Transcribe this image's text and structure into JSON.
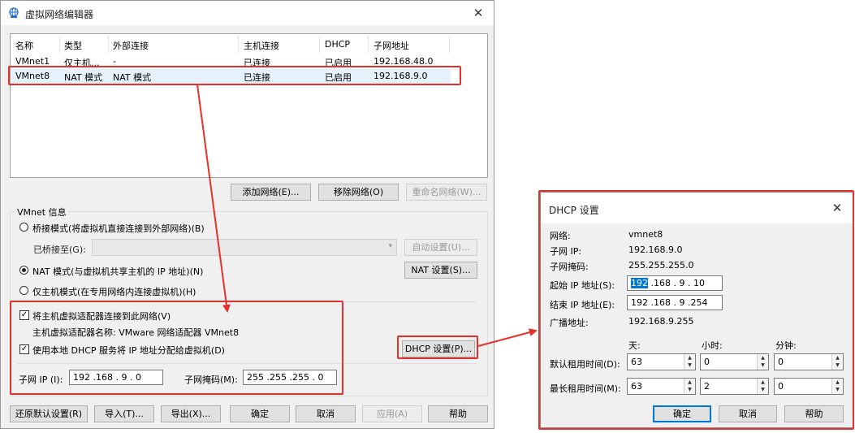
{
  "main_window": {
    "title": "虚拟网络编辑器",
    "close": "✕",
    "columns": [
      "名称",
      "类型",
      "外部连接",
      "主机连接",
      "DHCP",
      "子网地址"
    ],
    "rows": [
      [
        "VMnet1",
        "仅主机...",
        "-",
        "已连接",
        "已启用",
        "192.168.48.0"
      ],
      [
        "VMnet8",
        "NAT 模式",
        "NAT 模式",
        "已连接",
        "已启用",
        "192.168.9.0"
      ]
    ],
    "add_network": "添加网络(E)...",
    "remove_network": "移除网络(O)",
    "rename_network": "重命名网络(W)...",
    "vmnet_info": "VMnet 信息",
    "bridged_mode": "桥接模式(将虚拟机直接连接到外部网络)(B)",
    "bridged_to": "已桥接至(G):",
    "auto_settings": "自动设置(U)...",
    "nat_mode": "NAT 模式(与虚拟机共享主机的 IP 地址)(N)",
    "nat_settings": "NAT 设置(S)...",
    "host_only": "仅主机模式(在专用网络内连接虚拟机)(H)",
    "connect_adapter": "将主机虚拟适配器连接到此网络(V)",
    "adapter_name": "主机虚拟适配器名称: VMware 网络适配器 VMnet8",
    "use_dhcp": "使用本地 DHCP 服务将 IP 地址分配给虚拟机(D)",
    "dhcp_settings": "DHCP 设置(P)...",
    "subnet_ip_label": "子网 IP (I):",
    "subnet_ip": "192 .168 . 9 . 0",
    "subnet_mask_label": "子网掩码(M):",
    "subnet_mask": "255 .255 .255 . 0",
    "restore_defaults": "还原默认设置(R)",
    "import": "导入(T)...",
    "export": "导出(X)...",
    "ok": "确定",
    "cancel": "取消",
    "apply": "应用(A)",
    "help": "帮助"
  },
  "dhcp_dialog": {
    "title": "DHCP 设置",
    "close": "✕",
    "network_label": "网络:",
    "network": "vmnet8",
    "subnet_ip_label": "子网 IP:",
    "subnet_ip": "192.168.9.0",
    "subnet_mask_label": "子网掩码:",
    "subnet_mask": "255.255.255.0",
    "start_ip_label": "起始 IP 地址(S):",
    "start_ip_first": "192",
    "start_ip_rest": " .168 . 9 . 10",
    "end_ip_label": "结束 IP 地址(E):",
    "end_ip": "192 .168 . 9 .254",
    "broadcast_label": "广播地址:",
    "broadcast": "192.168.9.255",
    "days": "天:",
    "hours": "小时:",
    "minutes": "分钟:",
    "default_lease_label": "默认租用时间(D):",
    "default_lease": [
      "63",
      "0",
      "0"
    ],
    "max_lease_label": "最长租用时间(M):",
    "max_lease": [
      "63",
      "2",
      "0"
    ],
    "ok": "确定",
    "cancel": "取消",
    "help": "帮助"
  },
  "colors": {
    "annotation": "#e8302a",
    "selection": "#e5f1fb",
    "focus_blue": "#0078d7"
  }
}
